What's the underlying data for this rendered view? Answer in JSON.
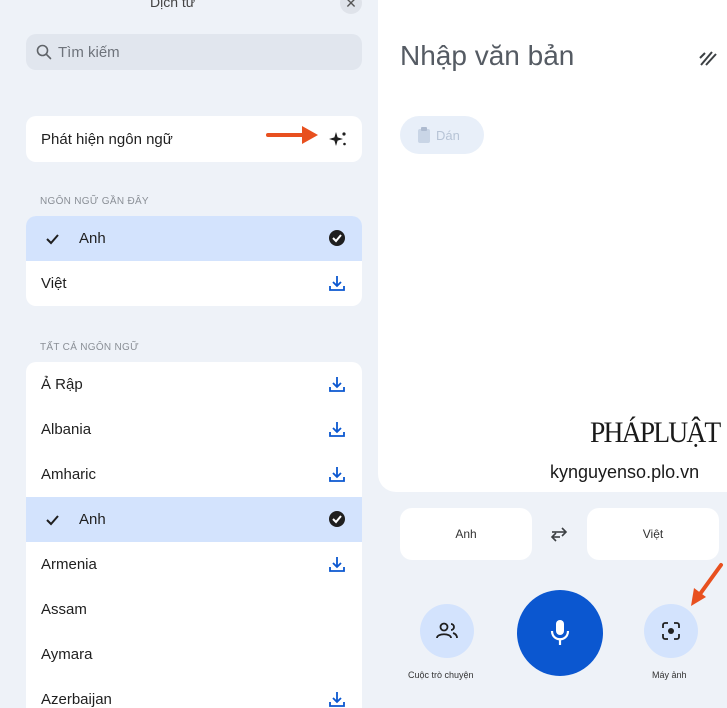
{
  "left_panel": {
    "top_title": "Dịch từ",
    "search": {
      "placeholder": "Tìm kiếm"
    },
    "detect_language": "Phát hiện ngôn ngữ",
    "recent_section": {
      "label": "NGÔN NGỮ GẦN ĐÂY",
      "items": [
        {
          "label": "Anh",
          "selected": true,
          "icon": "check-circle-icon"
        },
        {
          "label": "Việt",
          "selected": false,
          "icon": "download-icon"
        }
      ]
    },
    "all_section": {
      "label": "TẤT CẢ NGÔN NGỮ",
      "items": [
        {
          "label": "Ả Rập",
          "icon": "download-icon"
        },
        {
          "label": "Albania",
          "icon": "download-icon"
        },
        {
          "label": "Amharic",
          "icon": "download-icon"
        },
        {
          "label": "Anh",
          "selected": true,
          "icon": "check-circle-icon"
        },
        {
          "label": "Armenia",
          "icon": "download-icon"
        },
        {
          "label": "Assam",
          "icon": ""
        },
        {
          "label": "Aymara",
          "icon": ""
        },
        {
          "label": "Azerbaijan",
          "icon": "download-icon"
        }
      ]
    }
  },
  "right_panel": {
    "input_placeholder": "Nhập văn bản",
    "paste_label": "Dán",
    "watermark_brand": "PHÁPLUẬT",
    "watermark_site": "kynguyenso.plo.vn",
    "source_language": "Anh",
    "target_language": "Việt",
    "conversation_label": "Cuộc trò chuyện",
    "camera_label": "Máy ảnh"
  },
  "colors": {
    "accent": "#0b57d0",
    "selected_row": "#d3e3fd",
    "panel_bg": "#eef2f8",
    "annotation_arrow": "#e8501f"
  }
}
